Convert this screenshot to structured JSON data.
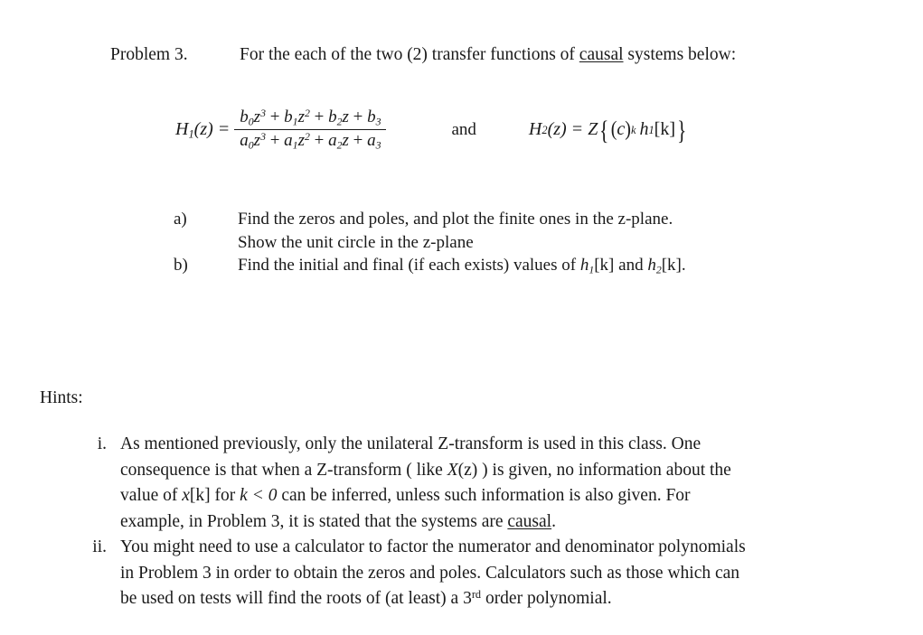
{
  "document": {
    "background_color": "#ffffff",
    "text_color": "#1a1a1a"
  },
  "problem": {
    "label": "Problem 3.",
    "statement_before_underline": "For the each of the two (2) transfer functions of ",
    "statement_underlined": "causal",
    "statement_after_underline": " systems below:"
  },
  "equations": {
    "h1": {
      "lhs": "H₁(z) =",
      "numerator": "b₀z³ + b₁z² + b₂z + b₃",
      "denominator": "a₀z³ + a₁z² + a₂z + a₃",
      "lhs_base": "H",
      "lhs_sub": "1",
      "lhs_arg": "(z) =",
      "num_terms": [
        {
          "coef": "b",
          "coef_sub": "0",
          "var": "z",
          "var_sup": "3"
        },
        {
          "coef": "b",
          "coef_sub": "1",
          "var": "z",
          "var_sup": "2"
        },
        {
          "coef": "b",
          "coef_sub": "2",
          "var": "z",
          "var_sup": ""
        },
        {
          "coef": "b",
          "coef_sub": "3",
          "var": "",
          "var_sup": ""
        }
      ],
      "den_terms": [
        {
          "coef": "a",
          "coef_sub": "0",
          "var": "z",
          "var_sup": "3"
        },
        {
          "coef": "a",
          "coef_sub": "1",
          "var": "z",
          "var_sup": "2"
        },
        {
          "coef": "a",
          "coef_sub": "2",
          "var": "z",
          "var_sup": ""
        },
        {
          "coef": "a",
          "coef_sub": "3",
          "var": "",
          "var_sup": ""
        }
      ]
    },
    "connector": "and",
    "h2": {
      "full": "H₂(z) = Z{(c)ᵏ h₁[k]}",
      "lhs_base": "H",
      "lhs_sub": "2",
      "lhs_arg": "(z) =",
      "operator": "Z",
      "brace_open": "{",
      "brace_close": "}",
      "paren_open": "(",
      "base": "c",
      "paren_close": ")",
      "exponent": "k",
      "func_base": "h",
      "func_sub": "1",
      "func_arg": "[k]"
    }
  },
  "subitems": [
    {
      "marker": "a)",
      "line1": "Find the zeros and poles, and plot the finite ones in the z-plane.",
      "line2": "Show the unit circle in the z-plane"
    },
    {
      "marker": "b)",
      "line1_pre": "Find the initial and final (if each exists) values of ",
      "line1_math1_base": "h",
      "line1_math1_sub": "1",
      "line1_math1_arg": "[k]",
      "line1_mid": " and ",
      "line1_math2_base": "h",
      "line1_math2_sub": "2",
      "line1_math2_arg": "[k]",
      "line1_end": "."
    }
  ],
  "hints": {
    "heading": "Hints:",
    "items": [
      {
        "numeral": "i.",
        "line1": "As mentioned previously, only the unilateral Z-transform is used in this class. One",
        "line2_pre": "consequence is that when a Z-transform ( like ",
        "line2_math_base": "X",
        "line2_math_arg": "(z)",
        "line2_post": "  ) is given, no information about the",
        "line3_pre": "value of ",
        "line3_math1_base": "x",
        "line3_math1_arg": "[k]",
        "line3_mid1": " for ",
        "line3_math2": "k < 0",
        "line3_post": " can be inferred, unless such information is also given. For",
        "line4_pre": "example, in Problem 3, it is stated that the systems are ",
        "line4_underlined": "causal",
        "line4_post": "."
      },
      {
        "numeral": "ii.",
        "line1": "You might need to use a calculator to factor the numerator and denominator polynomials",
        "line2": "in Problem 3 in order to obtain the zeros and poles. Calculators such as those which can",
        "line3_pre": "be used on tests will find the roots of (at least) a 3",
        "line3_ordinal": "rd",
        "line3_post": " order polynomial."
      }
    ]
  }
}
